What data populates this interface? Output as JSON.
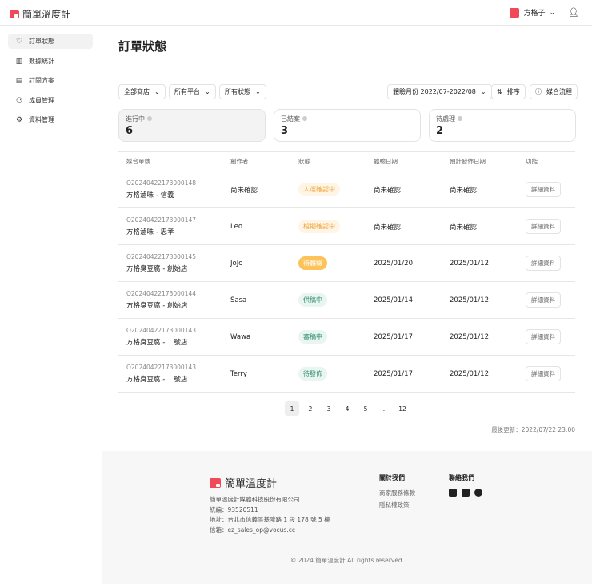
{
  "header": {
    "brand": "簡單溫度計",
    "user": "方格子"
  },
  "sidebar": {
    "items": [
      {
        "label": "訂單狀態",
        "icon": "handshake-icon"
      },
      {
        "label": "數據統計",
        "icon": "bar-chart-icon"
      },
      {
        "label": "訂閱方案",
        "icon": "plan-icon"
      },
      {
        "label": "成員管理",
        "icon": "users-icon"
      },
      {
        "label": "資料管理",
        "icon": "gear-icon"
      }
    ]
  },
  "page": {
    "title": "訂單狀態"
  },
  "filters": {
    "store": "全部商店",
    "platform": "所有平台",
    "status": "所有狀態",
    "month": "體驗月份 2022/07-2022/08",
    "sort": "排序",
    "flow": "媒合流程"
  },
  "cards": [
    {
      "label": "進行中",
      "value": "6"
    },
    {
      "label": "已結案",
      "value": "3"
    },
    {
      "label": "待處理",
      "value": "2"
    }
  ],
  "table": {
    "headers": [
      "媒合單號",
      "創作者",
      "狀態",
      "體驗日期",
      "預計發佈日期",
      "功能"
    ],
    "rows": [
      {
        "id": "O20240422173000148",
        "store": "方格滷味 - 信義",
        "creator": "尚未確認",
        "status": "人選確認中",
        "exp": "尚未確認",
        "pub": "尚未確認",
        "action": "詳細資料"
      },
      {
        "id": "O20240422173000147",
        "store": "方格滷味 - 忠孝",
        "creator": "Leo",
        "status": "檔期確認中",
        "exp": "尚未確認",
        "pub": "尚未確認",
        "action": "詳細資料"
      },
      {
        "id": "O20240422173000145",
        "store": "方格臭豆腐 - 創始店",
        "creator": "JoJo",
        "status": "待體驗",
        "exp": "2025/01/20",
        "pub": "2025/01/12",
        "action": "詳細資料"
      },
      {
        "id": "O20240422173000144",
        "store": "方格臭豆腐 - 創始店",
        "creator": "Sasa",
        "status": "供稿中",
        "exp": "2025/01/14",
        "pub": "2025/01/12",
        "action": "詳細資料"
      },
      {
        "id": "O20240422173000143",
        "store": "方格臭豆腐 - 二號店",
        "creator": "Wawa",
        "status": "審稿中",
        "exp": "2025/01/17",
        "pub": "2025/01/12",
        "action": "詳細資料"
      },
      {
        "id": "O20240422173000143",
        "store": "方格臭豆腐 - 二號店",
        "creator": "Terry",
        "status": "待發佈",
        "exp": "2025/01/17",
        "pub": "2025/01/12",
        "action": "詳細資料"
      }
    ]
  },
  "pagination": [
    "1",
    "2",
    "3",
    "4",
    "5",
    "...",
    "12"
  ],
  "updated": "最後更新：2022/07/22 23:00",
  "footer": {
    "brand": "簡單溫度計",
    "company": "簡單溫度計媒體科技股份有限公司",
    "tax": "統編：93520511",
    "address": "地址：台北市信義區基隆路 1 段 178 號 5 樓",
    "email": "信箱：ez_sales_op@vocus.cc",
    "about": "關於我們",
    "terms": "商家服務條款",
    "privacy": "隱私權政策",
    "contact": "聯絡我們",
    "copyright": "© 2024 簡單溫度計 All rights reserved."
  }
}
